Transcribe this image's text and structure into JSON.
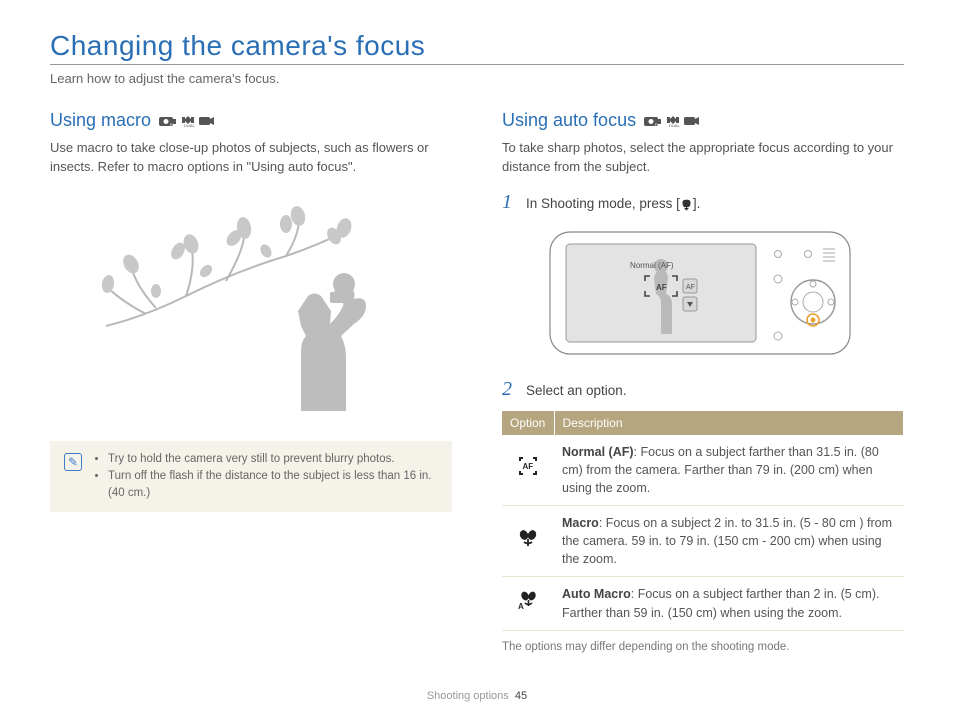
{
  "page": {
    "title": "Changing the camera's focus",
    "intro": "Learn how to adjust the camera's focus."
  },
  "left": {
    "heading": "Using macro",
    "body": "Use macro to take close-up photos of subjects, such as flowers or insects. Refer to macro options in \"Using auto focus\".",
    "note": {
      "items": [
        "Try to hold the camera very still to prevent blurry photos.",
        "Turn off the flash if the distance to the subject is less than 16 in. (40 cm.)"
      ]
    }
  },
  "right": {
    "heading": "Using auto focus",
    "body": "To take sharp photos, select the appropriate focus according to your distance from the subject.",
    "step1_prefix": "In Shooting mode, press [",
    "step1_suffix": "].",
    "step2": "Select an option.",
    "camera_label": "Normal (AF)",
    "table": {
      "head": {
        "option": "Option",
        "desc": "Description"
      },
      "rows": [
        {
          "icon": "af",
          "title": "Normal (AF)",
          "desc": ": Focus on a subject farther than 31.5 in. (80 cm) from the camera. Farther than 79 in. (200 cm) when using the zoom."
        },
        {
          "icon": "macro",
          "title": "Macro",
          "desc": ": Focus on a subject 2 in. to 31.5 in. (5 - 80 cm ) from the camera. 59 in. to 79 in. (150 cm - 200 cm) when using the zoom."
        },
        {
          "icon": "auto-macro",
          "title": "Auto Macro",
          "desc": ": Focus on a subject farther than 2 in. (5 cm). Farther than 59 in. (150 cm) when using the zoom."
        }
      ]
    },
    "table_note": "The options may differ depending on the shooting mode."
  },
  "footer": {
    "section": "Shooting options",
    "page_num": "45"
  }
}
